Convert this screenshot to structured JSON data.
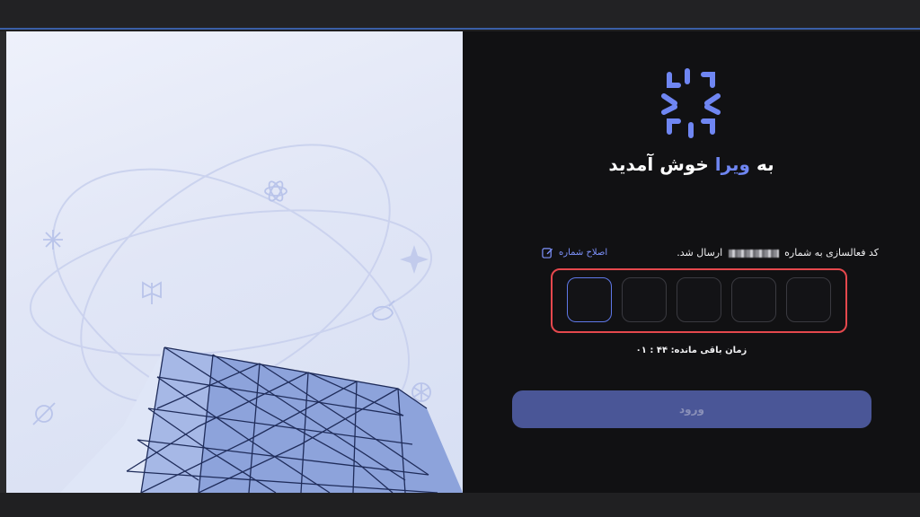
{
  "window": {
    "title": ""
  },
  "hero": {
    "orbit_icons": [
      "openai-icon",
      "atom-icon",
      "sparkle-icon",
      "star-icon",
      "whale-icon",
      "orbit-icon",
      "butterfly-icon"
    ]
  },
  "login": {
    "welcome_prefix": "به",
    "welcome_brand": "ویرا",
    "welcome_suffix": "خوش آمدید",
    "sent_text_before": "کد فعالسازی به شماره",
    "sent_text_after": "ارسال شد.",
    "edit_number_label": "اصلاح شماره",
    "otp_box_count": 5,
    "timer_label": "زمان باقی مانده:",
    "timer_value": "۴۴ : ۰۱",
    "submit_label": "ورود"
  },
  "colors": {
    "brand": "#6f86f2",
    "background": "#111113",
    "submit": "#4a5697",
    "highlight_frame": "#e5484d"
  }
}
